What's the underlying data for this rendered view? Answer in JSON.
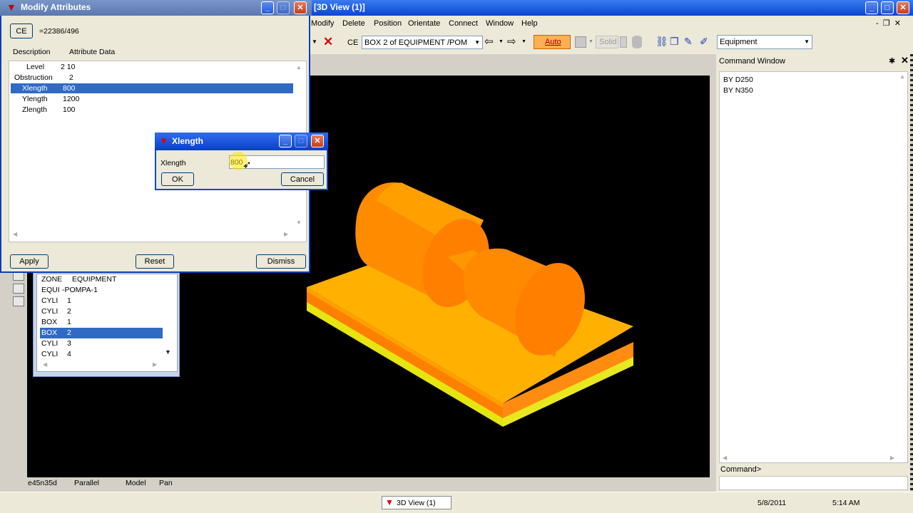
{
  "main_window": {
    "title": "[3D View (1)]",
    "menu": [
      "Modify",
      "Delete",
      "Position",
      "Orientate",
      "Connect",
      "Window",
      "Help"
    ],
    "toolbar": {
      "ce_label": "CE",
      "element_select": "BOX 2 of EQUIPMENT /POM",
      "auto_label": "Auto",
      "solid_label": "Solid",
      "module_select": "Equipment"
    }
  },
  "modify_attributes": {
    "title": "Modify Attributes",
    "ce_button": "CE",
    "ref": "=22386/496",
    "col_description": "Description",
    "col_data": "Attribute Data",
    "rows": [
      {
        "name": "Level",
        "value": "2 10"
      },
      {
        "name": "Obstruction",
        "value": "2"
      },
      {
        "name": "Xlength",
        "value": "800"
      },
      {
        "name": "Ylength",
        "value": "1200"
      },
      {
        "name": "Zlength",
        "value": "100"
      }
    ],
    "apply": "Apply",
    "reset": "Reset",
    "dismiss": "Dismiss"
  },
  "xlength_dialog": {
    "title": "Xlength",
    "label": "Xlength",
    "value": "800",
    "ok": "OK",
    "cancel": "Cancel"
  },
  "explorer": {
    "rows": [
      {
        "type": "ZONE",
        "name": "EQUIPMENT"
      },
      {
        "type": "EQUI",
        "name": "-POMPA-1"
      },
      {
        "type": "CYLI",
        "name": "1"
      },
      {
        "type": "CYLI",
        "name": "2"
      },
      {
        "type": "BOX",
        "name": "1"
      },
      {
        "type": "BOX",
        "name": "2"
      },
      {
        "type": "CYLI",
        "name": "3"
      },
      {
        "type": "CYLI",
        "name": "4"
      }
    ]
  },
  "view_status": {
    "direction": "e45n35d",
    "projection": "Parallel",
    "mode": "Model",
    "action": "Pan"
  },
  "command_window": {
    "title": "Command Window",
    "lines": [
      "BY D250",
      "BY N350"
    ],
    "prompt": "Command>"
  },
  "taskbar": {
    "item": "3D View (1)",
    "date": "5/8/2011",
    "time": "5:14 AM"
  },
  "colors": {
    "xp_title": "#0a3eb8",
    "selection": "#316ac5",
    "model_orange": "#ffb000",
    "model_dark_orange": "#ff8000",
    "model_yellow": "#e5e510"
  }
}
